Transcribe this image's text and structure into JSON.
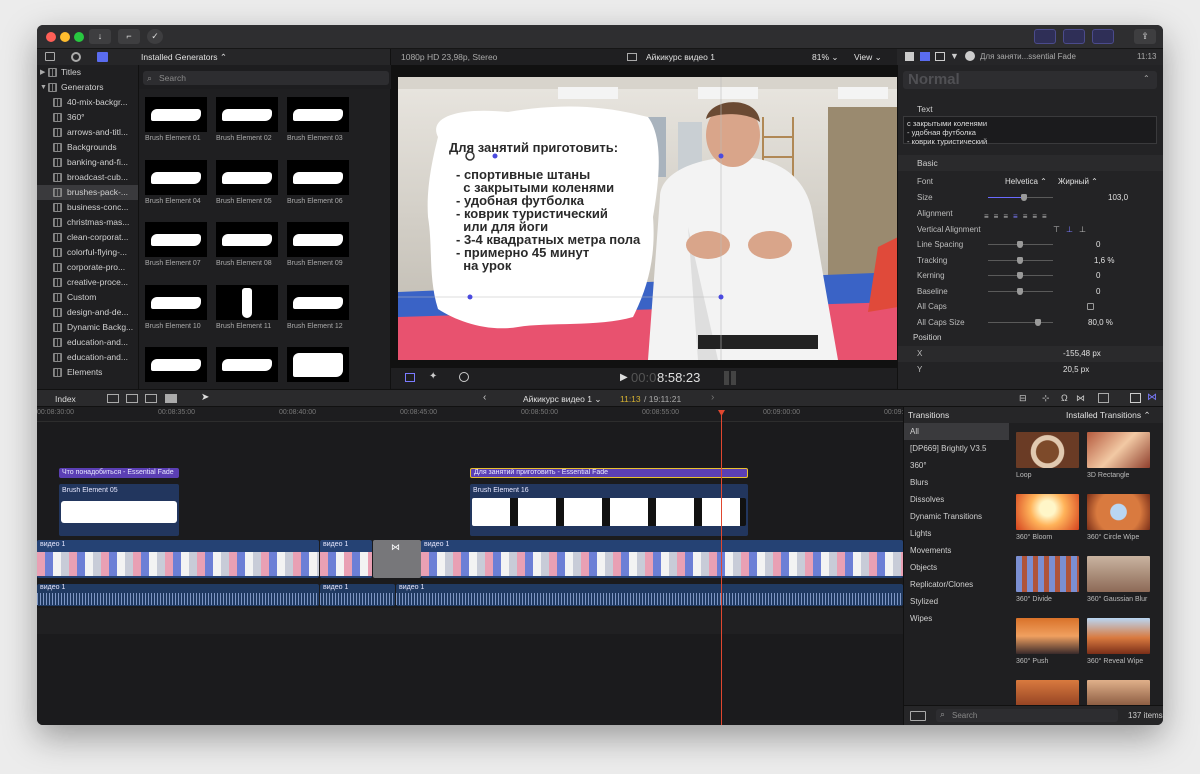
{
  "toolbar": {
    "download_icon": "↓",
    "key_icon": "⌐",
    "check_icon": "✓",
    "share_icon": "⇪"
  },
  "library": {
    "items": [
      {
        "label": "Titles",
        "top": true,
        "expanded": false
      },
      {
        "label": "Generators",
        "top": true,
        "expanded": true
      },
      {
        "label": "360°"
      },
      {
        "label": "40-mix-backgr..."
      },
      {
        "label": "arrows-and-titl..."
      },
      {
        "label": "Backgrounds"
      },
      {
        "label": "banking-and-fi..."
      },
      {
        "label": "broadcast-cub..."
      },
      {
        "label": "brushes-pack-...",
        "selected": true
      },
      {
        "label": "business-conc..."
      },
      {
        "label": "christmas-mas..."
      },
      {
        "label": "clean-corporat..."
      },
      {
        "label": "colorful-flying-..."
      },
      {
        "label": "corporate-pro..."
      },
      {
        "label": "creative-proce..."
      },
      {
        "label": "Custom"
      },
      {
        "label": "design-and-de..."
      },
      {
        "label": "Dynamic Backg..."
      },
      {
        "label": "education-and..."
      },
      {
        "label": "education-and..."
      },
      {
        "label": "Elements"
      }
    ]
  },
  "generators": {
    "header": "Installed Generators ⌃",
    "search_placeholder": "Search",
    "items": [
      "Brush Element 01",
      "Brush Element 02",
      "Brush Element 03",
      "Brush Element 04",
      "Brush Element 05",
      "Brush Element 06",
      "Brush Element 07",
      "Brush Element 08",
      "Brush Element 09",
      "Brush Element 10",
      "Brush Element 11",
      "Brush Element 12",
      "",
      "",
      ""
    ]
  },
  "viewer": {
    "format": "1080p HD 23,98p, Stereo",
    "project": "Айкикурс видео 1",
    "zoom": "81% ⌄",
    "view": "View ⌄",
    "timecode_dim": "00:0",
    "timecode": "8:58:23",
    "overlay_title": "Для занятий приготовить:",
    "overlay_lines": [
      "- спортивные штаны",
      "  с закрытыми коленями",
      "- удобная футболка",
      "- коврик туристический",
      "  или для йоги",
      "- 3-4 квадратных метра пола",
      "- примерно 45 минут",
      "  на урок"
    ]
  },
  "inspector": {
    "title": "Для заняти...ssential Fade",
    "time": "11:13",
    "style": "Normal",
    "text_label": "Text",
    "text_lines": [
      "с закрытыми коленями",
      "- удобная футболка",
      "- коврик туристический"
    ],
    "basic_label": "Basic",
    "font_label": "Font",
    "font_value": "Helvetica ⌃",
    "font_weight": "Жирный ⌃",
    "size_label": "Size",
    "size_value": "103,0",
    "size_fill": 0.55,
    "alignment_label": "Alignment",
    "valign_label": "Vertical Alignment",
    "line_spacing_label": "Line Spacing",
    "line_spacing_value": "0",
    "tracking_label": "Tracking",
    "tracking_value": "1,6  %",
    "kerning_label": "Kerning",
    "kerning_value": "0",
    "baseline_label": "Baseline",
    "baseline_value": "0",
    "allcaps_label": "All Caps",
    "allcaps_size_label": "All Caps Size",
    "allcaps_size_value": "80,0  %",
    "position_label": "Position",
    "x_label": "X",
    "x_value": "-155,48  px",
    "y_label": "Y",
    "y_value": "20,5  px"
  },
  "timeline": {
    "index_label": "Index",
    "project": "Айкикурс видео 1 ⌄",
    "time_current": "11:13",
    "time_total": "/ 19:11:21",
    "ruler": [
      "00:08:30:00",
      "00:08:35:00",
      "00:08:40:00",
      "00:08:45:00",
      "00:08:50:00",
      "00:08:55:00",
      "00:09:00:00",
      "00:09:05:00"
    ],
    "title_clip_1": "Что понадобиться - Essential Fade",
    "title_clip_2": "Для занятий приготовить - Essential Fade",
    "gen_clip_1": "Brush Element 05",
    "gen_clip_2": "Brush Element 16",
    "video_label": "видео 1",
    "audio_label": "видео 1"
  },
  "transitions": {
    "title": "Transitions",
    "installed": "Installed Transitions ⌃",
    "categories": [
      "All",
      "[DP669] Brightly V3.5",
      "360°",
      "Blurs",
      "Dissolves",
      "Dynamic Transitions",
      "Lights",
      "Movements",
      "Objects",
      "Replicator/Clones",
      "Stylized",
      "Wipes"
    ],
    "items": [
      "Loop",
      "3D Rectangle",
      "360° Bloom",
      "360° Circle Wipe",
      "360° Divide",
      "360° Gaussian Blur",
      "360° Push",
      "360° Reveal Wipe",
      "",
      ""
    ],
    "search_placeholder": "Search",
    "count": "137 items"
  }
}
